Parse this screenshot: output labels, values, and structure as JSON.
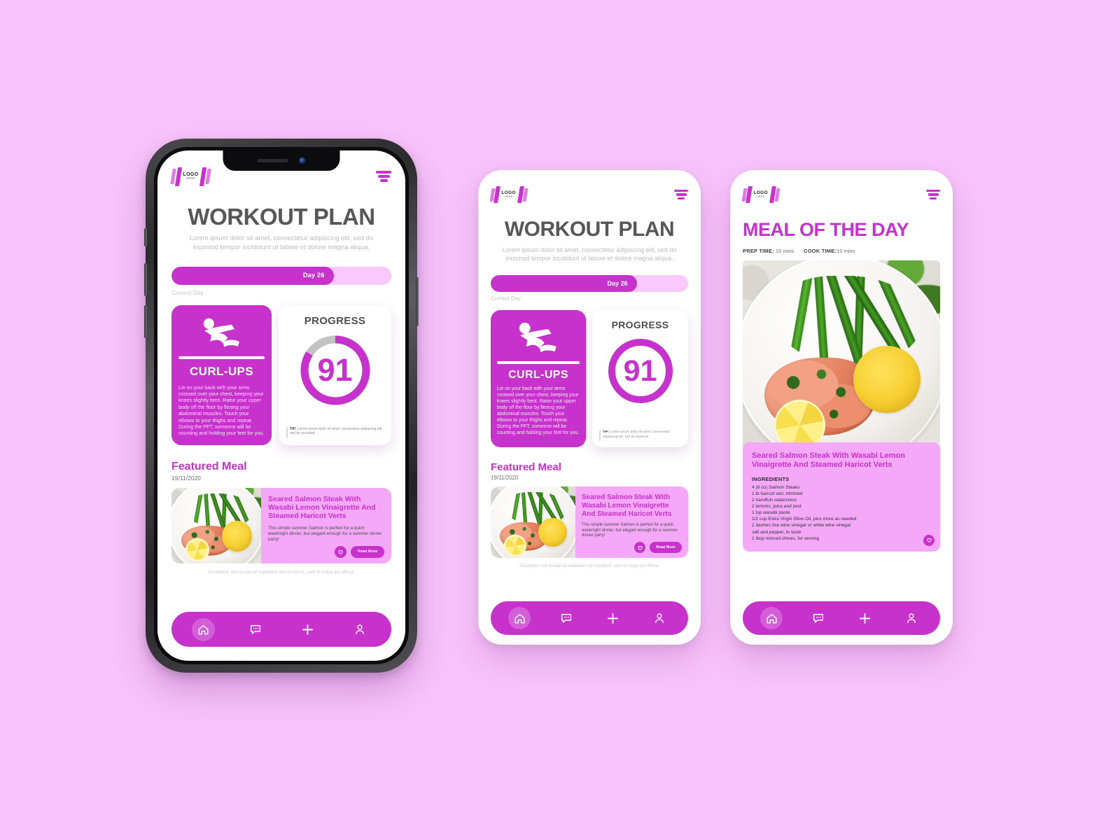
{
  "theme": {
    "background": "#f8c4fb",
    "accent": "#c732cd",
    "accent_light": "#f4a8f7",
    "accent_pale": "#f9c9fb",
    "title_gray": "#575757",
    "subtitle_gray": "#bcbcbc"
  },
  "brand": {
    "logo_line1": "LOGO",
    "logo_line2": "HERE",
    "logo_icon": "dumbbell-icon",
    "menu_icon": "funnel-menu-icon"
  },
  "workout_screen": {
    "title": "WORKOUT PLAN",
    "subtitle": "Lorem ipsum dolor sit amet, consectetur adipiscing elit, sed do eiusmod tempor incididunt ut labore et dolore magna aliqua.",
    "day_progress": {
      "label": "Day 26",
      "caption": "Current Day",
      "percent": 74
    },
    "exercise": {
      "icon": "curl-up-figure-icon",
      "name": "CURL-UPS",
      "description": "Lie on your back with your arms crossed over your chest, keeping your knees slightly bent. Raise your upper body off the floor by flexing your abdominal muscles. Touch your elbows to your thighs and repeat. During the PFT, someone will be counting and holding your feet for you."
    },
    "progress": {
      "title": "PROGRESS",
      "value": "91",
      "percent": 84,
      "tip_label": "TIP:",
      "tip_text": "Lorem ipsum dolor sit amet, consectetur adipiscing elit, sed do eiusmod"
    },
    "featured_meal": {
      "heading": "Featured Meal",
      "date": "19/11/2020",
      "name": "Seared Salmon Steak With Wasabi Lemon Vinaigrette And Steamed Haricot Verts",
      "description": "This simple summer Salmon is perfect for a quick weeknight dinner, but elegant enough for a summer dinner party!",
      "favorite_icon": "heart-icon",
      "read_more_label": "Read More",
      "photo_alt": "salmon-plate-photo"
    },
    "footnote": "Excepteur sint occaecat cupidatat non proident, sunt in culpa qui officia."
  },
  "meal_screen": {
    "title": "MEAL OF THE DAY",
    "prep_label": "PREP TIME:",
    "prep_value": "10 mins",
    "cook_label": "COOK TIME:",
    "cook_value": "10 mins",
    "photo_alt": "salmon-plate-hero-photo",
    "recipe_name": "Seared Salmon Steak With Wasabi Lemon Vinaigrette And Steamed Haricot Verts",
    "ingredients_heading": "INGREDIENTS",
    "ingredients": [
      "4 (6 oz) Salmon Steaks",
      "1 lb haricot vert, trimmed",
      "2 handfuls watercress",
      "2 lemons, juice and zest",
      "1 tsp wasabi paste",
      "1/2 cup Extra Virgin Olive Oil, plus more as needed",
      "2 dashes rice wine vinegar or white wine vinegar",
      "salt and pepper, to taste",
      "1 tbsp minced chives, for serving"
    ],
    "favorite_icon": "heart-icon"
  },
  "bottom_nav": {
    "items": [
      {
        "icon": "home-icon",
        "label": "Home",
        "active": true
      },
      {
        "icon": "chat-icon",
        "label": "Messages",
        "active": false
      },
      {
        "icon": "plus-icon",
        "label": "Add",
        "active": false
      },
      {
        "icon": "profile-icon",
        "label": "Profile",
        "active": false
      }
    ]
  }
}
